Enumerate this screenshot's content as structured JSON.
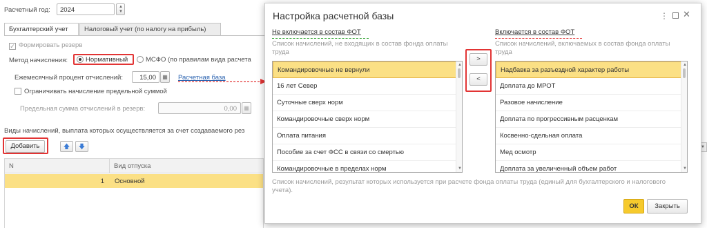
{
  "year_field": {
    "label": "Расчетный год:",
    "value": "2024"
  },
  "tabs": [
    {
      "label": "Бухгалтерский учет"
    },
    {
      "label": "Налоговый учет (по налогу на прибыль)"
    }
  ],
  "form": {
    "create_reserve_label": "Формировать резерв",
    "method_label": "Метод начисления:",
    "method_normative": "Нормативный",
    "method_msfo": "МСФО (по правилам вида расчета",
    "monthly_percent_label": "Ежемесячный процент отчислений:",
    "monthly_percent_value": "15,00",
    "calc_base_link": "Расчетная база",
    "limit_label": "Ограничивать начисление предельной суммой",
    "max_sum_label": "Предельная сумма отчислений в резерв:",
    "max_sum_value": "0,00"
  },
  "accruals": {
    "header_text": "Виды начислений, выплата которых осуществляется за счет создаваемого рез",
    "add_button": "Добавить",
    "columns": [
      "N",
      "Вид отпуска"
    ],
    "rows": [
      {
        "n": "1",
        "name": "Основной"
      }
    ]
  },
  "dialog": {
    "title": "Настройка расчетной базы",
    "left": {
      "header": "Не включается в состав ФОТ",
      "description": "Список начислений, не входящих в состав фонда оплаты труда",
      "items": [
        "Командировочные не вернули",
        "16 лет Север",
        "Суточные сверх норм",
        "Командировочные сверх норм",
        "Оплата питания",
        "Пособие за счет ФСС в связи со смертью",
        "Командировочные в пределах  норм"
      ]
    },
    "right": {
      "header": "Включается в состав ФОТ",
      "description": "Список начислений, включаемых в состав фонда оплаты труда",
      "items": [
        "Надбавка за разъездной характер работы",
        "Доплата до МРОТ",
        "Разовое начисление",
        "Доплата по прогрессивным расценкам",
        "Косвенно-сдельная оплата",
        "Мед осмотр",
        "Доплата за увеличенный объем работ"
      ]
    },
    "move_right": ">",
    "move_left": "<",
    "footer_note": "Список начислений, результат которых используется при расчете фонда оплаты труда (единый для бухгалтерского и налогового учета).",
    "ok_button": "ОК",
    "close_button": "Закрыть"
  },
  "colors": {
    "accent": "#f2c30f",
    "selection": "#fbe085",
    "annotation_red": "#e23434",
    "link": "#2b63b0"
  }
}
